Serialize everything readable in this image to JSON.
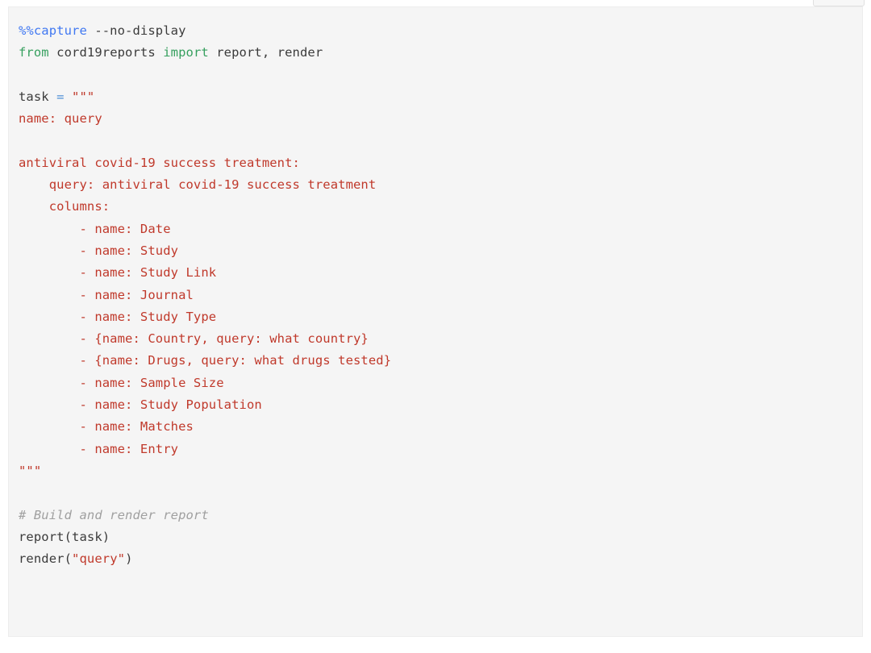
{
  "window": {
    "background_color": "#ffffff"
  },
  "toolbar": {
    "clipped_button_label": ""
  },
  "cell": {
    "type": "code",
    "background_color": "#f5f5f5",
    "border_color": "#ededed",
    "language": "python"
  },
  "colors": {
    "magic": "#4078f2",
    "keyword": "#37a05f",
    "operator": "#4d8fd6",
    "string": "#c0392b",
    "comment": "#a0a0a0",
    "text": "#3b3b3b"
  },
  "code": {
    "lines": [
      {
        "id": "l01",
        "tokens": [
          {
            "t": "magic",
            "v": "%%capture"
          },
          {
            "t": "plain",
            "v": " --no-display"
          }
        ]
      },
      {
        "id": "l02",
        "tokens": [
          {
            "t": "kw",
            "v": "from"
          },
          {
            "t": "plain",
            "v": " cord19reports "
          },
          {
            "t": "kw",
            "v": "import"
          },
          {
            "t": "plain",
            "v": " report, render"
          }
        ]
      },
      {
        "id": "l03",
        "tokens": []
      },
      {
        "id": "l04",
        "tokens": [
          {
            "t": "plain",
            "v": "task "
          },
          {
            "t": "op",
            "v": "="
          },
          {
            "t": "plain",
            "v": " "
          },
          {
            "t": "str",
            "v": "\"\"\""
          }
        ]
      },
      {
        "id": "l05",
        "tokens": [
          {
            "t": "str",
            "v": "name: query"
          }
        ]
      },
      {
        "id": "l06",
        "tokens": []
      },
      {
        "id": "l07",
        "tokens": [
          {
            "t": "str",
            "v": "antiviral covid-19 success treatment:"
          }
        ]
      },
      {
        "id": "l08",
        "tokens": [
          {
            "t": "str",
            "v": "    query: antiviral covid-19 success treatment"
          }
        ]
      },
      {
        "id": "l09",
        "tokens": [
          {
            "t": "str",
            "v": "    columns:"
          }
        ]
      },
      {
        "id": "l10",
        "tokens": [
          {
            "t": "str",
            "v": "        - name: Date"
          }
        ]
      },
      {
        "id": "l11",
        "tokens": [
          {
            "t": "str",
            "v": "        - name: Study"
          }
        ]
      },
      {
        "id": "l12",
        "tokens": [
          {
            "t": "str",
            "v": "        - name: Study Link"
          }
        ]
      },
      {
        "id": "l13",
        "tokens": [
          {
            "t": "str",
            "v": "        - name: Journal"
          }
        ]
      },
      {
        "id": "l14",
        "tokens": [
          {
            "t": "str",
            "v": "        - name: Study Type"
          }
        ]
      },
      {
        "id": "l15",
        "tokens": [
          {
            "t": "str",
            "v": "        - {name: Country, query: what country}"
          }
        ]
      },
      {
        "id": "l16",
        "tokens": [
          {
            "t": "str",
            "v": "        - {name: Drugs, query: what drugs tested}"
          }
        ]
      },
      {
        "id": "l17",
        "tokens": [
          {
            "t": "str",
            "v": "        - name: Sample Size"
          }
        ]
      },
      {
        "id": "l18",
        "tokens": [
          {
            "t": "str",
            "v": "        - name: Study Population"
          }
        ]
      },
      {
        "id": "l19",
        "tokens": [
          {
            "t": "str",
            "v": "        - name: Matches"
          }
        ]
      },
      {
        "id": "l20",
        "tokens": [
          {
            "t": "str",
            "v": "        - name: Entry"
          }
        ]
      },
      {
        "id": "l21",
        "tokens": [
          {
            "t": "str",
            "v": "\"\"\""
          }
        ]
      },
      {
        "id": "l22",
        "tokens": []
      },
      {
        "id": "l23",
        "tokens": [
          {
            "t": "comment",
            "v": "# Build and render report"
          }
        ]
      },
      {
        "id": "l24",
        "tokens": [
          {
            "t": "plain",
            "v": "report(task)"
          }
        ]
      },
      {
        "id": "l25",
        "tokens": [
          {
            "t": "plain",
            "v": "render("
          },
          {
            "t": "strq",
            "v": "\"query\""
          },
          {
            "t": "plain",
            "v": ")"
          }
        ]
      }
    ],
    "task_yaml": {
      "name": "query",
      "report_name": "antiviral covid-19 success treatment",
      "query": "antiviral covid-19 success treatment",
      "columns": [
        {
          "name": "Date"
        },
        {
          "name": "Study"
        },
        {
          "name": "Study Link"
        },
        {
          "name": "Journal"
        },
        {
          "name": "Study Type"
        },
        {
          "name": "Country",
          "query": "what country"
        },
        {
          "name": "Drugs",
          "query": "what drugs tested"
        },
        {
          "name": "Sample Size"
        },
        {
          "name": "Study Population"
        },
        {
          "name": "Matches"
        },
        {
          "name": "Entry"
        }
      ]
    }
  }
}
